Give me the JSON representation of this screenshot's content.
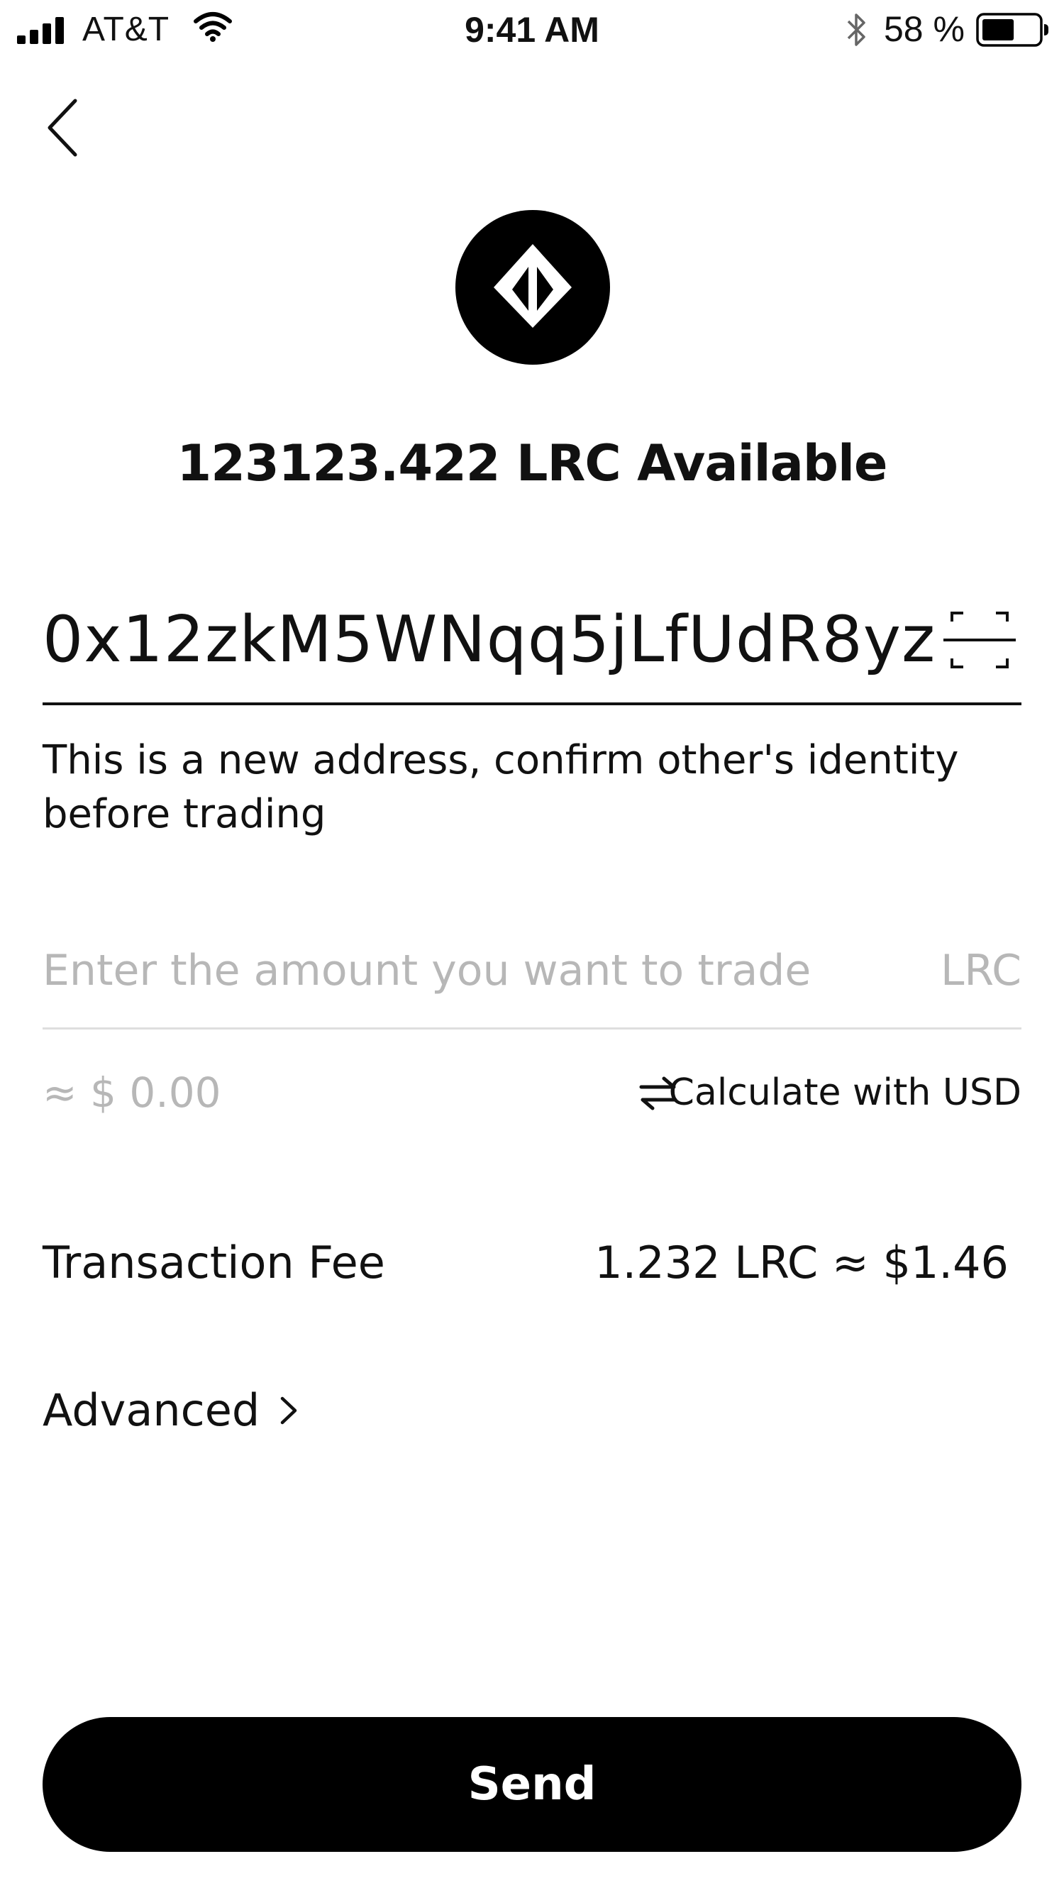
{
  "status_bar": {
    "carrier": "AT&T",
    "time": "9:41 AM",
    "battery_percent": "58 %",
    "battery_level": 0.58,
    "icons": [
      "signal-icon",
      "wifi-icon",
      "bluetooth-icon",
      "battery-icon"
    ]
  },
  "header": {
    "back_icon": "back-chevron-icon"
  },
  "token": {
    "logo_icon": "loopring-logo-icon",
    "balance_text": "123123.422 LRC  Available"
  },
  "address": {
    "value": "0x12zkM5WNqq5jLfUdR8yz",
    "scan_icon": "scan-qr-icon",
    "warning": "This is a new address, confirm other's identity before trading"
  },
  "amount": {
    "placeholder": "Enter the amount you want to trade",
    "unit": "LRC",
    "usd_equivalent": "≈ $ 0.00",
    "calculate_label": "Calculate with USD",
    "swap_icon": "swap-arrows-icon"
  },
  "fee": {
    "label": "Transaction Fee",
    "value": "1.232 LRC ≈ $1.46"
  },
  "advanced": {
    "label": "Advanced",
    "chevron_icon": "chevron-right-icon"
  },
  "send_button": {
    "label": "Send"
  },
  "colors": {
    "primary": "#000000",
    "text": "#111111",
    "placeholder": "#b7b7b7",
    "divider": "#dedede"
  }
}
